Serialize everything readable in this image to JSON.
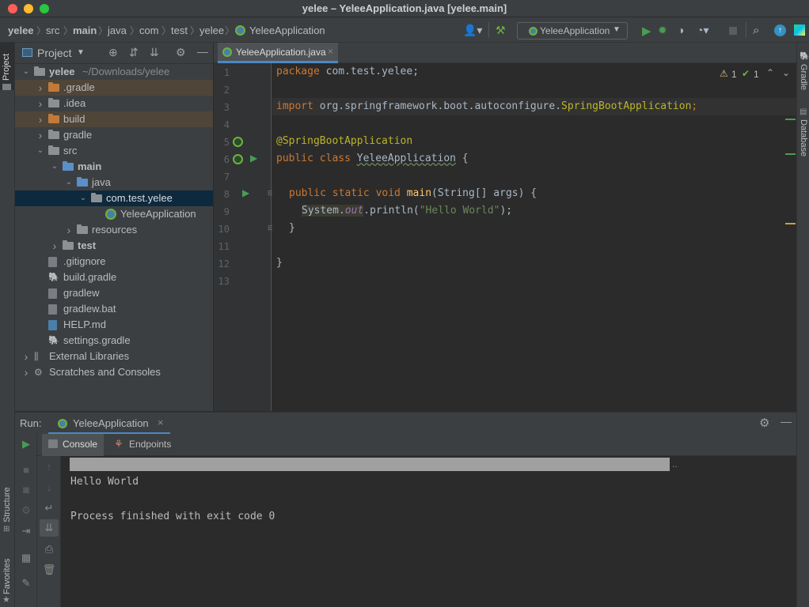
{
  "window": {
    "title": "yelee – YeleeApplication.java [yelee.main]"
  },
  "breadcrumb": [
    "yelee",
    "src",
    "main",
    "java",
    "com",
    "test",
    "yelee",
    "YeleeApplication"
  ],
  "toolbar": {
    "run_config": "YeleeApplication"
  },
  "left_stripe": {
    "project": "Project",
    "structure": "Structure",
    "favorites": "Favorites"
  },
  "right_stripe": {
    "gradle": "Gradle",
    "database": "Database"
  },
  "project_panel": {
    "title": "Project",
    "tree": [
      {
        "label": "yelee",
        "suffix": "~/Downloads/yelee",
        "depth": 0,
        "expanded": true,
        "type": "module",
        "bold": true
      },
      {
        "label": ".gradle",
        "depth": 1,
        "expanded": false,
        "type": "folder-orange",
        "hl": "excluded"
      },
      {
        "label": ".idea",
        "depth": 1,
        "expanded": false,
        "type": "folder"
      },
      {
        "label": "build",
        "depth": 1,
        "expanded": false,
        "type": "folder-orange",
        "hl": "excluded"
      },
      {
        "label": "gradle",
        "depth": 1,
        "expanded": false,
        "type": "folder"
      },
      {
        "label": "src",
        "depth": 1,
        "expanded": true,
        "type": "folder"
      },
      {
        "label": "main",
        "depth": 2,
        "expanded": true,
        "type": "folder-blue",
        "bold": true
      },
      {
        "label": "java",
        "depth": 3,
        "expanded": true,
        "type": "folder-blue"
      },
      {
        "label": "com.test.yelee",
        "depth": 4,
        "expanded": true,
        "type": "package",
        "hl": "selected"
      },
      {
        "label": "YeleeApplication",
        "depth": 5,
        "type": "spring-class"
      },
      {
        "label": "resources",
        "depth": 3,
        "expanded": false,
        "type": "folder"
      },
      {
        "label": "test",
        "depth": 2,
        "expanded": false,
        "type": "folder",
        "bold": true
      },
      {
        "label": ".gitignore",
        "depth": 1,
        "type": "file"
      },
      {
        "label": "build.gradle",
        "depth": 1,
        "type": "gradle-file"
      },
      {
        "label": "gradlew",
        "depth": 1,
        "type": "file"
      },
      {
        "label": "gradlew.bat",
        "depth": 1,
        "type": "file"
      },
      {
        "label": "HELP.md",
        "depth": 1,
        "type": "md-file"
      },
      {
        "label": "settings.gradle",
        "depth": 1,
        "type": "gradle-file"
      },
      {
        "label": "External Libraries",
        "depth": 0,
        "expanded": false,
        "type": "libraries"
      },
      {
        "label": "Scratches and Consoles",
        "depth": 0,
        "expanded": false,
        "type": "scratches"
      }
    ]
  },
  "editor": {
    "tab_label": "YeleeApplication.java",
    "inspections": {
      "warnings": "1",
      "ok": "1"
    },
    "line_numbers": [
      "1",
      "2",
      "3",
      "4",
      "5",
      "6",
      "7",
      "8",
      "9",
      "10",
      "11",
      "12",
      "13"
    ],
    "code": {
      "l1_kw": "package",
      "l1_rest": " com.test.yelee;",
      "l3_kw": "import",
      "l3_pkg": " org.springframework.boot.autoconfigure.",
      "l3_cls": "SpringBootApplication",
      "l3_end": ";",
      "l5_ann": "@SpringBootApplication",
      "l6_kw": "public class ",
      "l6_name": "YeleeApplication",
      "l6_end": " {",
      "l8_kw": "public static void ",
      "l8_fn": "main",
      "l8_end": "(String[] args) {",
      "l9_sys": "System.",
      "l9_out": "out",
      "l9_mid": ".println(",
      "l9_str": "\"Hello World\"",
      "l9_end": ");",
      "l10": "}",
      "l12": "}"
    }
  },
  "run_panel": {
    "label": "Run:",
    "tab": "YeleeApplication",
    "subtabs": {
      "console": "Console",
      "endpoints": "Endpoints"
    },
    "console_lines": [
      "Hello World",
      "",
      "Process finished with exit code 0"
    ],
    "scroll_more": ".."
  },
  "colors": {
    "accent": "#4a88c7",
    "run_green": "#499c54",
    "spring_green": "#6cb33e"
  }
}
